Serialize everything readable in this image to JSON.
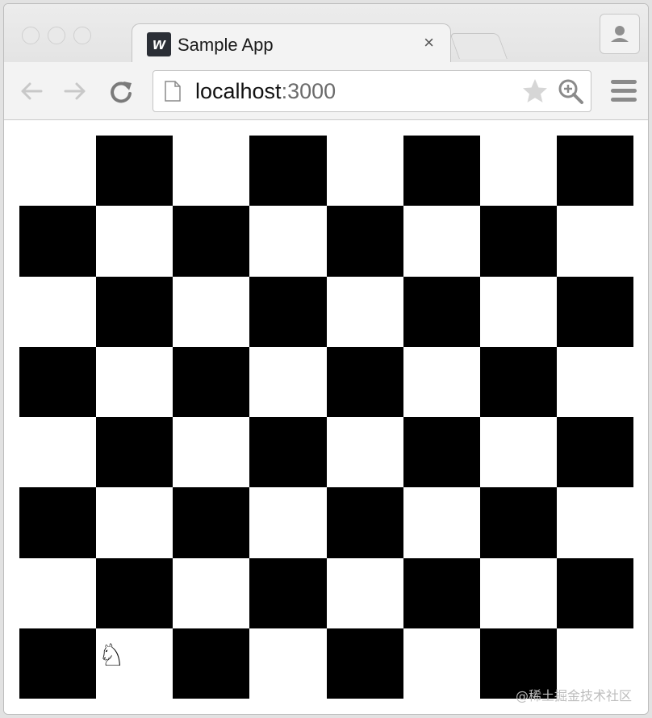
{
  "tab": {
    "title": "Sample App",
    "favicon_letter": "w",
    "close_glyph": "×"
  },
  "address": {
    "host": "localhost",
    "port": ":3000"
  },
  "board": {
    "size": 8,
    "dark_color": "#000000",
    "light_color": "#ffffff",
    "pieces": [
      {
        "row": 7,
        "col": 1,
        "glyph": "♘",
        "name": "knight"
      }
    ]
  },
  "icons": [
    "back-arrow-icon",
    "forward-arrow-icon",
    "reload-icon",
    "page-icon",
    "star-icon",
    "zoom-icon",
    "menu-icon",
    "profile-icon"
  ],
  "watermark": "@稀土掘金技术社区"
}
